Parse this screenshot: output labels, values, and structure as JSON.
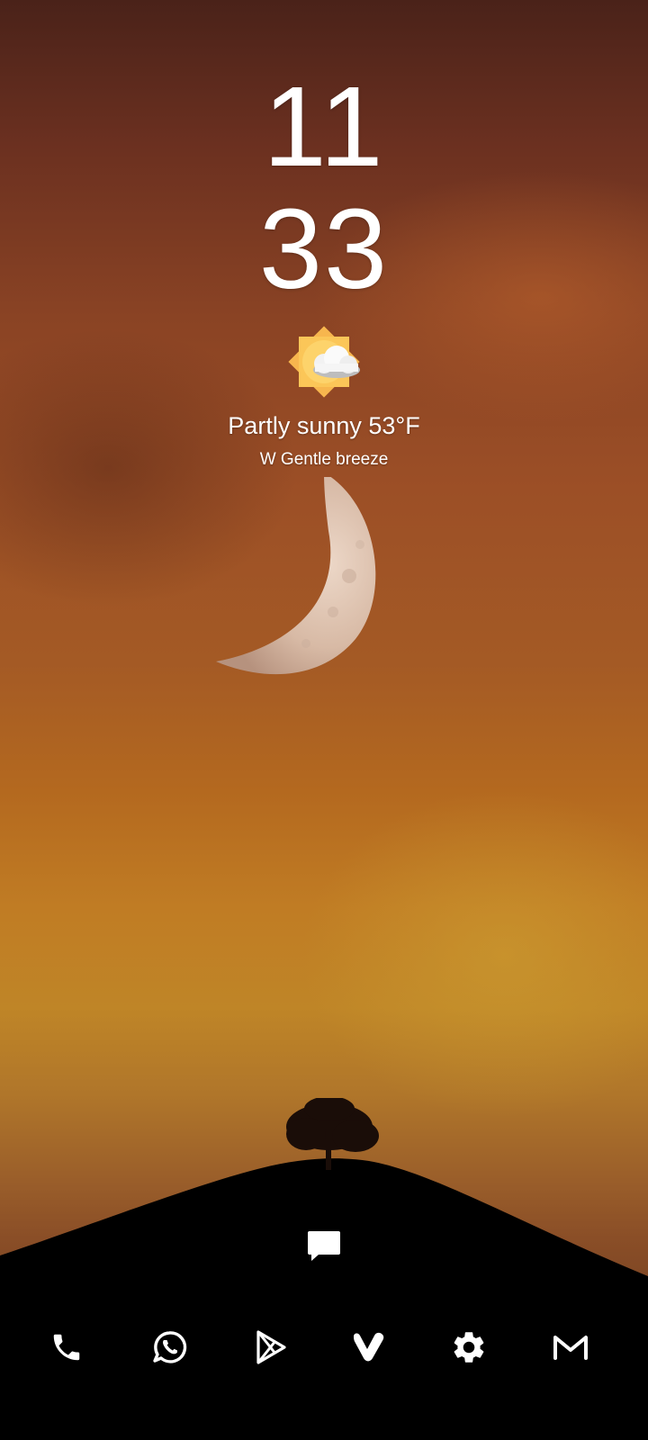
{
  "clock": {
    "hours": "11",
    "minutes": "33"
  },
  "weather": {
    "condition_text": "Partly sunny 53°F",
    "wind_text": "W Gentle breeze",
    "icon": "partly-sunny-icon"
  },
  "home": {
    "top_shortcut": {
      "icon": "message-icon",
      "app": "Messages"
    }
  },
  "dock": {
    "items": [
      {
        "icon": "phone-icon",
        "app": "Phone"
      },
      {
        "icon": "whatsapp-icon",
        "app": "WhatsApp"
      },
      {
        "icon": "play-store-icon",
        "app": "Play Store"
      },
      {
        "icon": "vivaldi-icon",
        "app": "Vivaldi"
      },
      {
        "icon": "settings-gear-icon",
        "app": "Settings"
      },
      {
        "icon": "gmail-icon",
        "app": "Gmail"
      }
    ]
  },
  "colors": {
    "sky_top": "#4a2219",
    "sky_mid": "#a45a25",
    "sky_glow": "#c07c24",
    "hill": "#000000",
    "icon": "#ffffff"
  }
}
